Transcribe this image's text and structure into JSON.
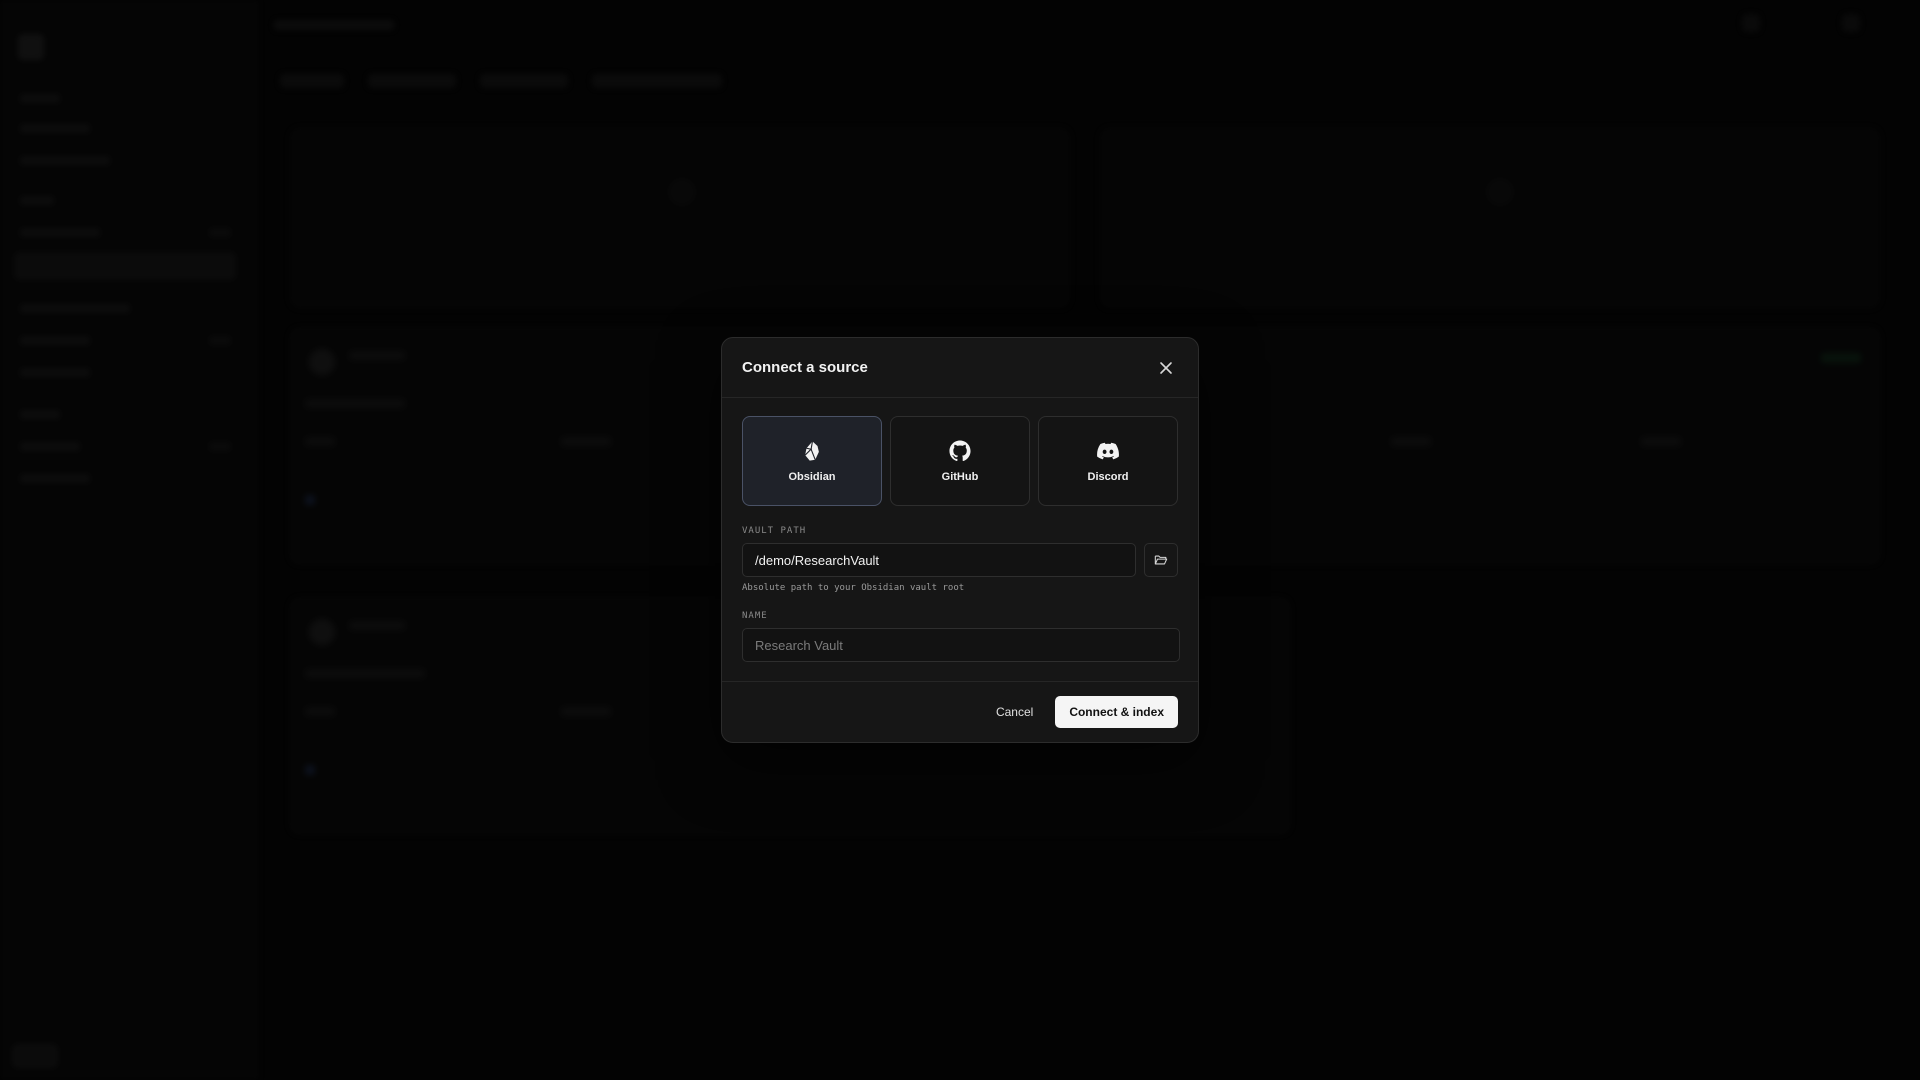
{
  "modal": {
    "title": "Connect a source",
    "sources": [
      {
        "label": "Obsidian",
        "icon": "obsidian-icon",
        "selected": true
      },
      {
        "label": "GitHub",
        "icon": "github-icon",
        "selected": false
      },
      {
        "label": "Discord",
        "icon": "discord-icon",
        "selected": false
      }
    ],
    "vault_path": {
      "label": "VAULT PATH",
      "value": "/demo/ResearchVault",
      "hint": "Absolute path to your Obsidian vault root"
    },
    "name": {
      "label": "NAME",
      "placeholder": "Research Vault"
    },
    "cancel_label": "Cancel",
    "submit_label": "Connect & index"
  },
  "colors": {
    "modal_bg": "#161616",
    "selected_card_bg": "#1f2229",
    "selected_card_border": "#4a5266",
    "primary_button_bg": "#f5f5f5"
  }
}
